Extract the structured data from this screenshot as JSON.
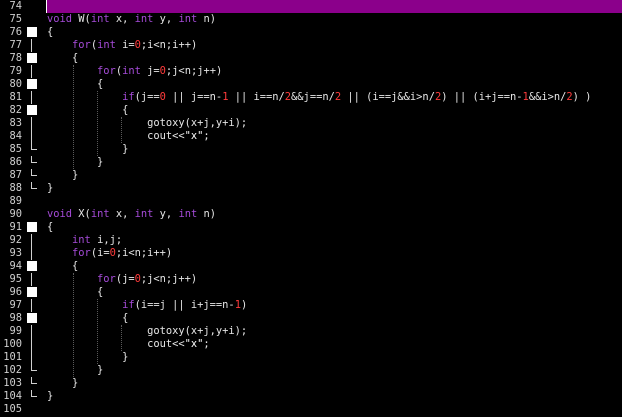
{
  "colors": {
    "background": "#000000",
    "current_line": "#8b008b",
    "keyword": "#a54bd8",
    "number": "#ff3b3b",
    "plain": "#e6e6e6",
    "line_number": "#d0d0d0"
  },
  "editor": {
    "line_numbers": [
      "74",
      "75",
      "76",
      "77",
      "78",
      "79",
      "80",
      "81",
      "82",
      "83",
      "84",
      "85",
      "86",
      "87",
      "88",
      "89",
      "90",
      "91",
      "92",
      "93",
      "94",
      "95",
      "96",
      "97",
      "98",
      "99",
      "100",
      "101",
      "102",
      "103",
      "104",
      "105"
    ],
    "current_line": "74",
    "lines": [
      [],
      [
        {
          "t": "void",
          "c": "kw"
        },
        {
          "t": " W(",
          "c": "plain"
        },
        {
          "t": "int",
          "c": "kw"
        },
        {
          "t": " x, ",
          "c": "plain"
        },
        {
          "t": "int",
          "c": "kw"
        },
        {
          "t": " y, ",
          "c": "plain"
        },
        {
          "t": "int",
          "c": "kw"
        },
        {
          "t": " n)",
          "c": "plain"
        }
      ],
      [
        {
          "t": "{",
          "c": "plain"
        }
      ],
      [
        {
          "t": "    ",
          "c": "plain"
        },
        {
          "t": "for",
          "c": "kw"
        },
        {
          "t": "(",
          "c": "plain"
        },
        {
          "t": "int",
          "c": "kw"
        },
        {
          "t": " i=",
          "c": "plain"
        },
        {
          "t": "0",
          "c": "num"
        },
        {
          "t": ";i<n;i++)",
          "c": "plain"
        }
      ],
      [
        {
          "t": "    {",
          "c": "plain"
        }
      ],
      [
        {
          "t": "        ",
          "c": "plain"
        },
        {
          "t": "for",
          "c": "kw"
        },
        {
          "t": "(",
          "c": "plain"
        },
        {
          "t": "int",
          "c": "kw"
        },
        {
          "t": " j=",
          "c": "plain"
        },
        {
          "t": "0",
          "c": "num"
        },
        {
          "t": ";j<n;j++)",
          "c": "plain"
        }
      ],
      [
        {
          "t": "        {",
          "c": "plain"
        }
      ],
      [
        {
          "t": "            ",
          "c": "plain"
        },
        {
          "t": "if",
          "c": "kw"
        },
        {
          "t": "(j==",
          "c": "plain"
        },
        {
          "t": "0",
          "c": "num"
        },
        {
          "t": " || j==n-",
          "c": "plain"
        },
        {
          "t": "1",
          "c": "num"
        },
        {
          "t": " || i==n/",
          "c": "plain"
        },
        {
          "t": "2",
          "c": "num"
        },
        {
          "t": "&&j==n/",
          "c": "plain"
        },
        {
          "t": "2",
          "c": "num"
        },
        {
          "t": " || (i==j&&i>n/",
          "c": "plain"
        },
        {
          "t": "2",
          "c": "num"
        },
        {
          "t": ") || (i+j==n-",
          "c": "plain"
        },
        {
          "t": "1",
          "c": "num"
        },
        {
          "t": "&&i>n/",
          "c": "plain"
        },
        {
          "t": "2",
          "c": "num"
        },
        {
          "t": ") )",
          "c": "plain"
        }
      ],
      [
        {
          "t": "            {",
          "c": "plain"
        }
      ],
      [
        {
          "t": "                gotoxy(x+j,y+i);",
          "c": "plain"
        }
      ],
      [
        {
          "t": "                cout<<",
          "c": "plain"
        },
        {
          "t": "\"x\"",
          "c": "str"
        },
        {
          "t": ";",
          "c": "plain"
        }
      ],
      [
        {
          "t": "            }",
          "c": "plain"
        }
      ],
      [
        {
          "t": "        }",
          "c": "plain"
        }
      ],
      [
        {
          "t": "    }",
          "c": "plain"
        }
      ],
      [
        {
          "t": "}",
          "c": "plain"
        }
      ],
      [],
      [
        {
          "t": "void",
          "c": "kw"
        },
        {
          "t": " X(",
          "c": "plain"
        },
        {
          "t": "int",
          "c": "kw"
        },
        {
          "t": " x, ",
          "c": "plain"
        },
        {
          "t": "int",
          "c": "kw"
        },
        {
          "t": " y, ",
          "c": "plain"
        },
        {
          "t": "int",
          "c": "kw"
        },
        {
          "t": " n)",
          "c": "plain"
        }
      ],
      [
        {
          "t": "{",
          "c": "plain"
        }
      ],
      [
        {
          "t": "    ",
          "c": "plain"
        },
        {
          "t": "int",
          "c": "kw"
        },
        {
          "t": " i,j;",
          "c": "plain"
        }
      ],
      [
        {
          "t": "    ",
          "c": "plain"
        },
        {
          "t": "for",
          "c": "kw"
        },
        {
          "t": "(i=",
          "c": "plain"
        },
        {
          "t": "0",
          "c": "num"
        },
        {
          "t": ";i<n;i++)",
          "c": "plain"
        }
      ],
      [
        {
          "t": "    {",
          "c": "plain"
        }
      ],
      [
        {
          "t": "        ",
          "c": "plain"
        },
        {
          "t": "for",
          "c": "kw"
        },
        {
          "t": "(j=",
          "c": "plain"
        },
        {
          "t": "0",
          "c": "num"
        },
        {
          "t": ";j<n;j++)",
          "c": "plain"
        }
      ],
      [
        {
          "t": "        {",
          "c": "plain"
        }
      ],
      [
        {
          "t": "            ",
          "c": "plain"
        },
        {
          "t": "if",
          "c": "kw"
        },
        {
          "t": "(i==j || i+j==n-",
          "c": "plain"
        },
        {
          "t": "1",
          "c": "num"
        },
        {
          "t": ")",
          "c": "plain"
        }
      ],
      [
        {
          "t": "            {",
          "c": "plain"
        }
      ],
      [
        {
          "t": "                gotoxy(x+j,y+i);",
          "c": "plain"
        }
      ],
      [
        {
          "t": "                cout<<",
          "c": "plain"
        },
        {
          "t": "\"x\"",
          "c": "str"
        },
        {
          "t": ";",
          "c": "plain"
        }
      ],
      [
        {
          "t": "            }",
          "c": "plain"
        }
      ],
      [
        {
          "t": "        }",
          "c": "plain"
        }
      ],
      [
        {
          "t": "    }",
          "c": "plain"
        }
      ],
      [
        {
          "t": "}",
          "c": "plain"
        }
      ],
      []
    ],
    "fold_markers": [
      "",
      "",
      "box",
      "vline",
      "box",
      "vline",
      "box",
      "vline",
      "box",
      "vline",
      "vline",
      "end",
      "end",
      "end",
      "end",
      "",
      "",
      "box",
      "vline",
      "vline",
      "box",
      "vline",
      "box",
      "vline",
      "box",
      "vline",
      "vline",
      "vline",
      "end",
      "end",
      "end",
      ""
    ]
  }
}
